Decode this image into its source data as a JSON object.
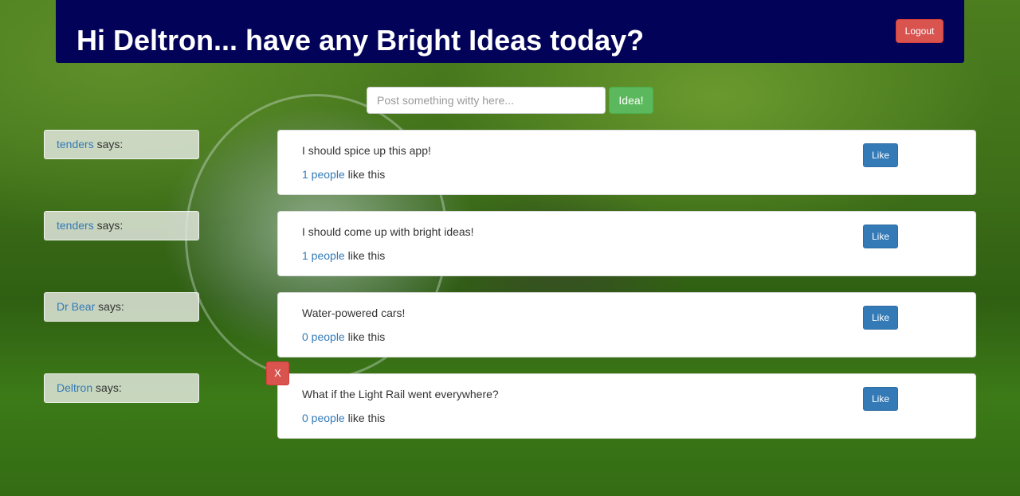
{
  "header": {
    "title": "Hi Deltron... have any Bright Ideas today?",
    "logout_label": "Logout"
  },
  "post_form": {
    "placeholder": "Post something witty here...",
    "submit_label": "Idea!"
  },
  "says_label": "says:",
  "like_label": "Like",
  "likes_suffix": "like this",
  "delete_label": "X",
  "ideas": [
    {
      "author": "tenders",
      "text": "I should spice up this app!",
      "likes": "1 people"
    },
    {
      "author": "tenders",
      "text": "I should come up with bright ideas!",
      "likes": "1 people"
    },
    {
      "author": "Dr Bear",
      "text": "Water-powered cars!",
      "likes": "0 people"
    },
    {
      "author": "Deltron",
      "text": "What if the Light Rail went everywhere?",
      "likes": "0 people"
    }
  ],
  "colors": {
    "header_bg": "#020259",
    "danger": "#d9534f",
    "success": "#5cb85c",
    "primary": "#337ab7"
  }
}
